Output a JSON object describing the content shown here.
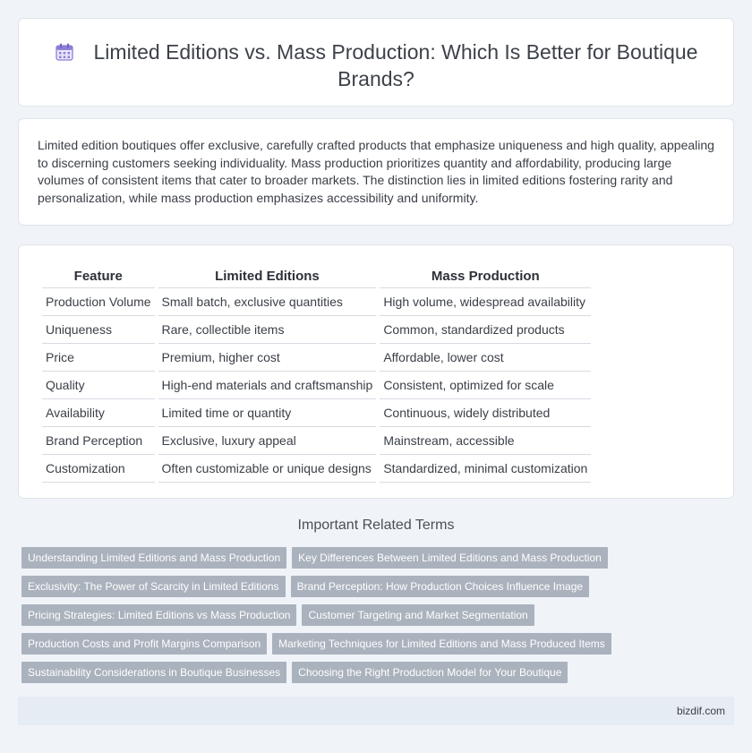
{
  "header": {
    "title": "Limited Editions vs. Mass Production: Which Is Better for Boutique Brands?",
    "icon": "calendar-icon"
  },
  "intro": {
    "text": "Limited edition boutiques offer exclusive, carefully crafted products that emphasize uniqueness and high quality, appealing to discerning customers seeking individuality. Mass production prioritizes quantity and affordability, producing large volumes of consistent items that cater to broader markets. The distinction lies in limited editions fostering rarity and personalization, while mass production emphasizes accessibility and uniformity."
  },
  "comparison": {
    "headers": [
      "Feature",
      "Limited Editions",
      "Mass Production"
    ],
    "rows": [
      [
        "Production Volume",
        "Small batch, exclusive quantities",
        "High volume, widespread availability"
      ],
      [
        "Uniqueness",
        "Rare, collectible items",
        "Common, standardized products"
      ],
      [
        "Price",
        "Premium, higher cost",
        "Affordable, lower cost"
      ],
      [
        "Quality",
        "High-end materials and craftsmanship",
        "Consistent, optimized for scale"
      ],
      [
        "Availability",
        "Limited time or quantity",
        "Continuous, widely distributed"
      ],
      [
        "Brand Perception",
        "Exclusive, luxury appeal",
        "Mainstream, accessible"
      ],
      [
        "Customization",
        "Often customizable or unique designs",
        "Standardized, minimal customization"
      ]
    ]
  },
  "related": {
    "heading": "Important Related Terms",
    "tags": [
      "Understanding Limited Editions and Mass Production",
      "Key Differences Between Limited Editions and Mass Production",
      "Exclusivity: The Power of Scarcity in Limited Editions",
      "Brand Perception: How Production Choices Influence Image",
      "Pricing Strategies: Limited Editions vs Mass Production",
      "Customer Targeting and Market Segmentation",
      "Production Costs and Profit Margins Comparison",
      "Marketing Techniques for Limited Editions and Mass Produced Items",
      "Sustainability Considerations in Boutique Businesses",
      "Choosing the Right Production Model for Your Boutique"
    ]
  },
  "footer": {
    "site": "bizdif.com"
  },
  "colors": {
    "background": "#f0f4f9",
    "tag": "#aab2bd",
    "icon_accent": "#8b7fd6"
  }
}
